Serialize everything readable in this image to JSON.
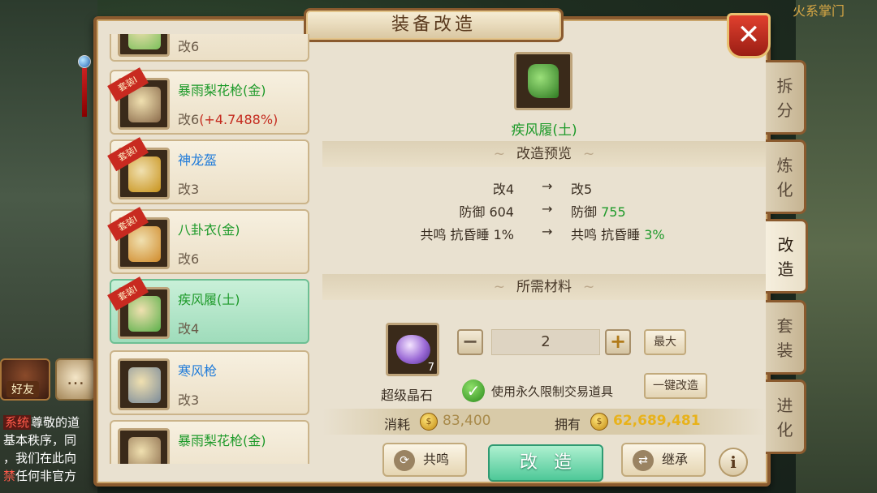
{
  "background": {
    "topright_text": "火系掌门"
  },
  "hud": {
    "friend_label": "好友",
    "chat_lines": [
      {
        "prefix": "系统",
        "text": "尊敬的道"
      },
      {
        "prefix": "",
        "text": "基本秩序，同"
      },
      {
        "prefix": "",
        "text": "，我们在此向"
      },
      {
        "prefix": "禁",
        "text": "任何非官方"
      }
    ]
  },
  "dialog": {
    "title": "装备改造",
    "close_icon": "✕"
  },
  "equipment_list": [
    {
      "name": "",
      "level": "改6",
      "bonus": "",
      "badge": "",
      "name_color": "green",
      "selected": false,
      "art_color": "#7ac05a"
    },
    {
      "name": "暴雨梨花枪(金)",
      "level": "改6",
      "bonus": "(+4.7488%)",
      "badge": "套装I",
      "name_color": "green",
      "selected": false,
      "art_color": "#8a6a4a"
    },
    {
      "name": "神龙盔",
      "level": "改3",
      "bonus": "",
      "badge": "套装I",
      "name_color": "blue",
      "selected": false,
      "art_color": "#c8921a"
    },
    {
      "name": "八卦衣(金)",
      "level": "改6",
      "bonus": "",
      "badge": "套装I",
      "name_color": "green",
      "selected": false,
      "art_color": "#d08a2a"
    },
    {
      "name": "疾风履(土)",
      "level": "改4",
      "bonus": "",
      "badge": "套装I",
      "name_color": "green",
      "selected": true,
      "art_color": "#5ab04a"
    },
    {
      "name": "寒风枪",
      "level": "改3",
      "bonus": "",
      "badge": "",
      "name_color": "blue",
      "selected": false,
      "art_color": "#7a8a9a"
    },
    {
      "name": "暴雨梨花枪(金)",
      "level": "",
      "bonus": "",
      "badge": "",
      "name_color": "green",
      "selected": false,
      "art_color": "#8a6a4a"
    }
  ],
  "selected_equipment": {
    "name": "疾风履(土)"
  },
  "preview": {
    "heading": "改造预览",
    "rows": [
      {
        "left": "改4",
        "arrow": "→",
        "right_label": "改5",
        "right_value": ""
      },
      {
        "left": "防御 604",
        "arrow": "→",
        "right_label": "防御",
        "right_value": "755"
      },
      {
        "left": "共鸣  抗昏睡 1%",
        "arrow": "→",
        "right_label": "共鸣  抗昏睡",
        "right_value": "3%"
      }
    ]
  },
  "materials": {
    "heading": "所需材料",
    "item_name": "超级晶石",
    "item_count": "7",
    "quantity": "2",
    "minus_icon": "−",
    "plus_icon": "+",
    "max_label": "最大",
    "use_bound_label": "使用永久限制交易道具",
    "one_click_label": "一键改造",
    "checked": true
  },
  "cost": {
    "consume_label": "消耗",
    "consume_value": "83,400",
    "own_label": "拥有",
    "own_value": "62,689,481"
  },
  "actions": {
    "resonance_label": "共鸣",
    "modify_label": "改造",
    "inherit_label": "继承",
    "info_icon": "i"
  },
  "side_tabs": [
    {
      "label": "拆分",
      "active": false
    },
    {
      "label": "炼化",
      "active": false
    },
    {
      "label": "改造",
      "active": true
    },
    {
      "label": "套装",
      "active": false
    },
    {
      "label": "进化",
      "active": false
    }
  ]
}
